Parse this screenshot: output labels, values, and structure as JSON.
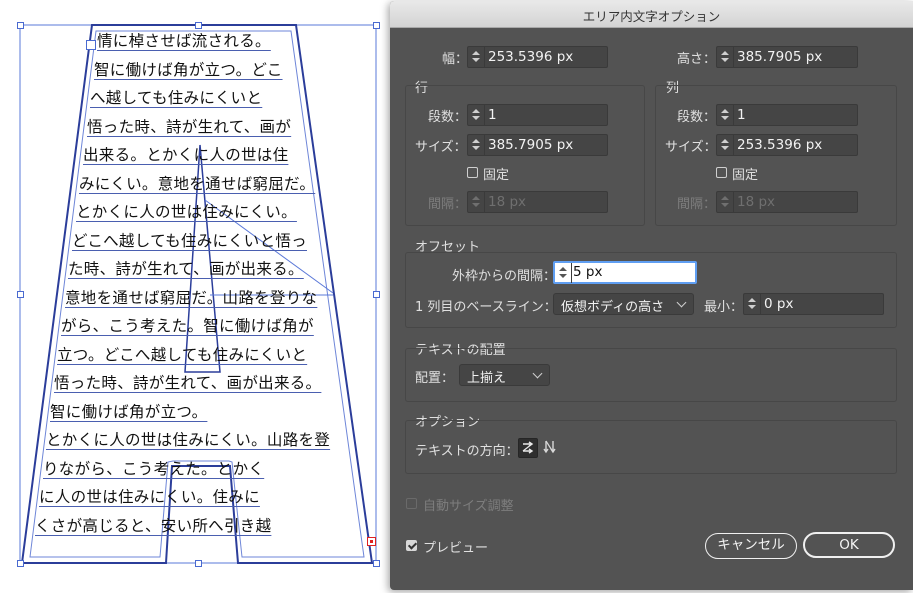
{
  "canvas": {
    "text_lines": [
      "情に棹させば流される。",
      "智に働けば角が立つ。どこ",
      "へ越しても住みにくいと",
      "悟った時、詩が生れて、画が",
      "出来る。とかくに人の世は住",
      "みにくい。意地を通せば窮屈だ。",
      "とかくに人の世は住みにくい。",
      "どこへ越しても住みにくいと悟っ",
      "た時、詩が生れて、画が出来る。",
      "意地を通せば窮屈だ。山路を登りな",
      "がら、こう考えた。智に働けば角が",
      "立つ。どこへ越しても住みにくいと",
      "悟った時、詩が生れて、画が出来る。",
      "智に働けば角が立つ。",
      "とかくに人の世は住みにくい。山路を登",
      "りながら、こう考えた。とかく",
      "に人の世は住みにくい。住みに",
      "くさが高じると、安い所へ引き越"
    ]
  },
  "dialog": {
    "title": "エリア内文字オプション",
    "width_label": "幅：",
    "width_value": "253.5396 px",
    "height_label": "高さ：",
    "height_value": "385.7905 px",
    "rows": {
      "title": "行",
      "count_label": "段数：",
      "count_value": "1",
      "size_label": "サイズ：",
      "size_value": "385.7905 px",
      "fixed_label": "固定",
      "gutter_label": "間隔：",
      "gutter_value": "18 px"
    },
    "columns": {
      "title": "列",
      "count_label": "段数：",
      "count_value": "1",
      "size_label": "サイズ：",
      "size_value": "253.5396 px",
      "fixed_label": "固定",
      "gutter_label": "間隔：",
      "gutter_value": "18 px"
    },
    "offset": {
      "title": "オフセット",
      "inset_label": "外枠からの間隔：",
      "inset_value": "5 px",
      "baseline_label": "1 列目のベースライン：",
      "baseline_value": "仮想ボディの高さ",
      "min_label": "最小：",
      "min_value": "0 px"
    },
    "alignment": {
      "title": "テキストの配置",
      "label": "配置：",
      "value": "上揃え"
    },
    "options": {
      "title": "オプション",
      "direction_label": "テキストの方向："
    },
    "auto_size_label": "自動サイズ調整",
    "preview_label": "プレビュー",
    "preview_checked": true,
    "cancel_label": "キャンセル",
    "ok_label": "OK"
  }
}
